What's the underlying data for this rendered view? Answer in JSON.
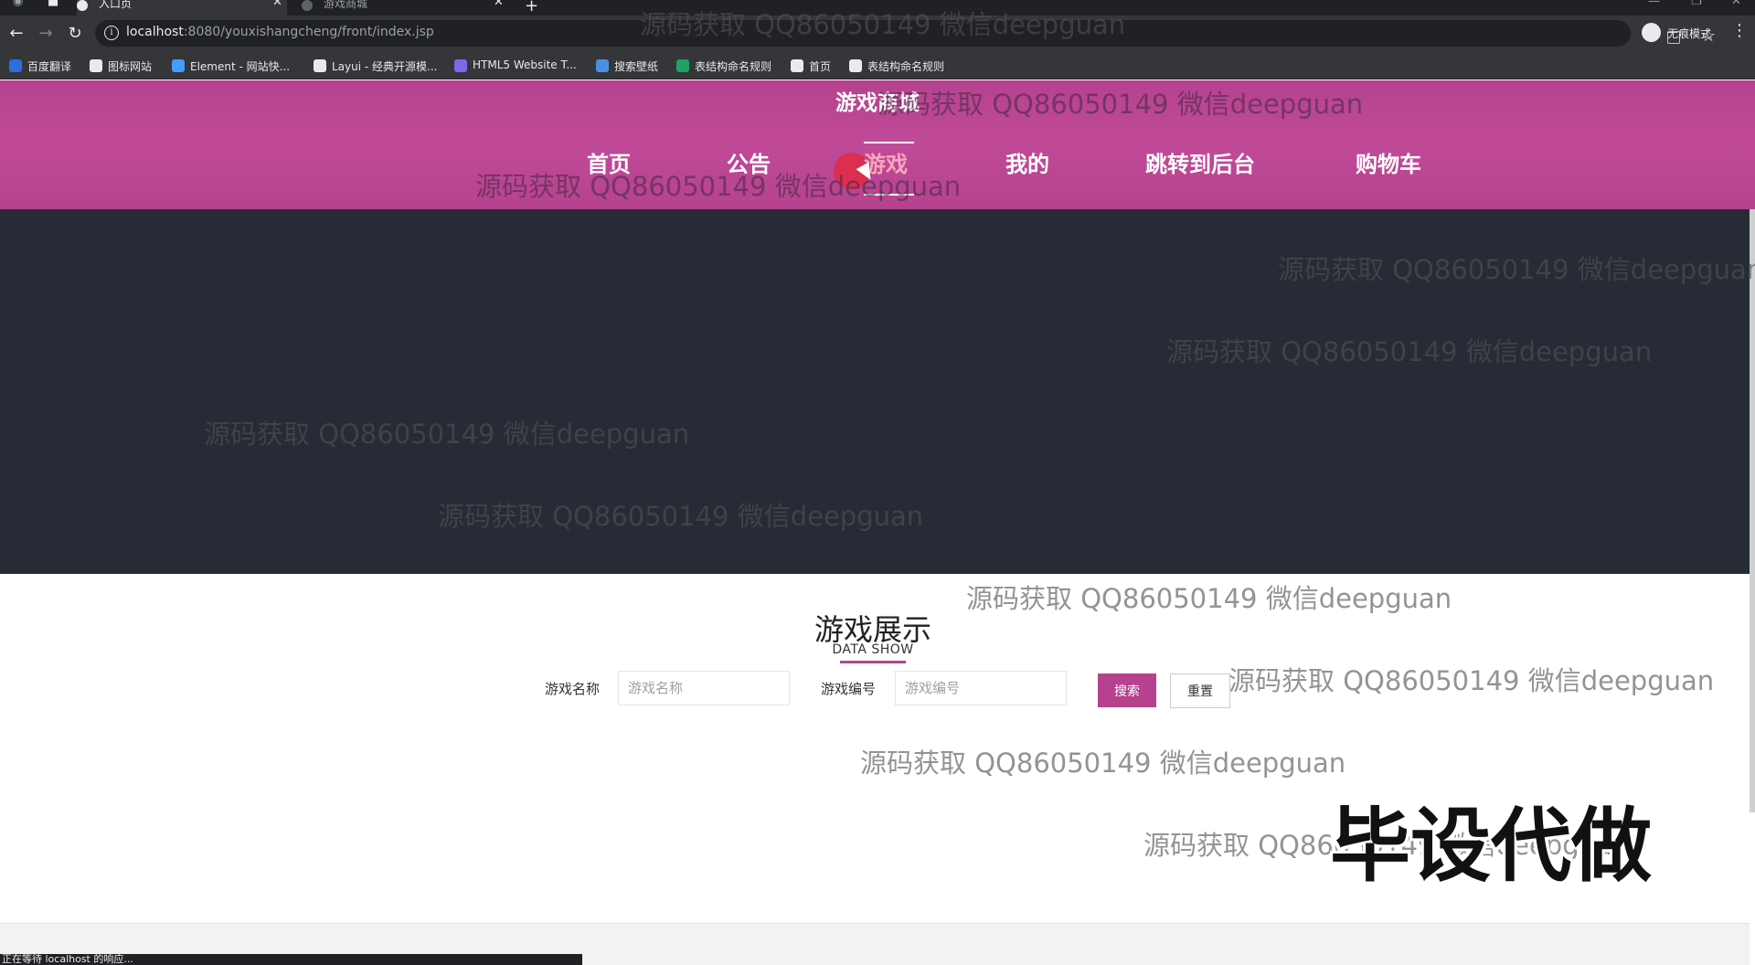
{
  "browser": {
    "tabs": [
      {
        "label": "入口页",
        "active": true
      },
      {
        "label": "游戏商城",
        "active": false
      }
    ],
    "url_host": "localhost",
    "url_rest": ":8080/youxishangcheng/front/index.jsp",
    "profile_label": "无痕模式",
    "bookmarks": [
      {
        "label": "百度翻译",
        "icon": "baidu-translate-icon",
        "color": "#2e6ce0"
      },
      {
        "label": "图标网站",
        "icon": "flag-icon",
        "color": "#e8eaed"
      },
      {
        "label": "Element - 网站快...",
        "icon": "element-icon",
        "color": "#409eff"
      },
      {
        "label": "Layui - 经典开源模...",
        "icon": "layui-icon",
        "color": "#e8eaed"
      },
      {
        "label": "HTML5 Website T...",
        "icon": "html5-icon",
        "color": "#7b68ee"
      },
      {
        "label": "搜索壁纸",
        "icon": "wallpaper-icon",
        "color": "#4a90e2"
      },
      {
        "label": "表结构命名规则",
        "icon": "sheet-icon",
        "color": "#1ea362"
      },
      {
        "label": "首页",
        "icon": "globe-icon",
        "color": "#e8eaed"
      },
      {
        "label": "表结构命名规则",
        "icon": "globe-icon",
        "color": "#e8eaed"
      }
    ],
    "status_text": "正在等待 localhost 的响应..."
  },
  "site": {
    "title": "游戏商城",
    "nav": [
      {
        "label": "首页",
        "active": false
      },
      {
        "label": "公告",
        "active": false
      },
      {
        "label": "游戏",
        "active": true
      },
      {
        "label": "我的",
        "active": false
      },
      {
        "label": "跳转到后台",
        "active": false
      },
      {
        "label": "购物车",
        "active": false
      }
    ],
    "accent_color": "#b6428f"
  },
  "section": {
    "title": "游戏展示",
    "subtitle": "DATA SHOW"
  },
  "filters": {
    "name_label": "游戏名称",
    "name_placeholder": "游戏名称",
    "code_label": "游戏编号",
    "code_placeholder": "游戏编号",
    "search_label": "搜索",
    "reset_label": "重置"
  },
  "watermarks": {
    "text": "源码获取 QQ86050149 微信deepguan",
    "stamp": "毕设代做"
  }
}
